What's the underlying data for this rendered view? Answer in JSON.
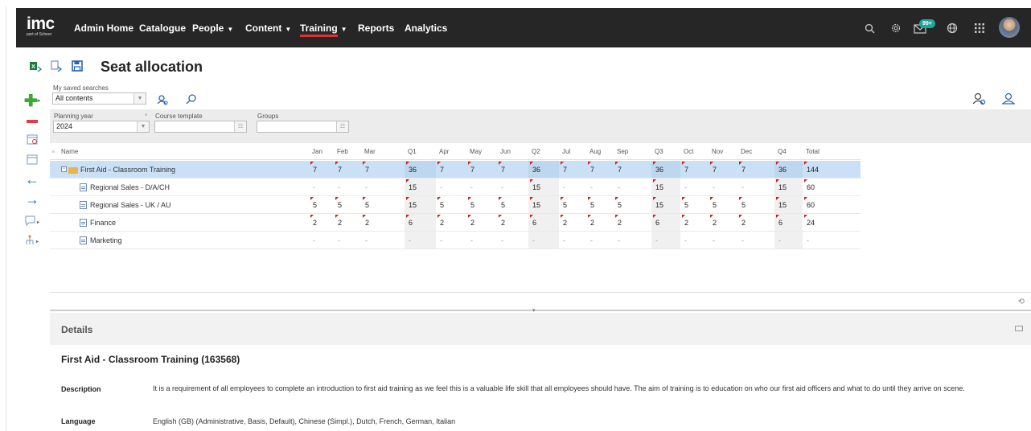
{
  "app": {
    "logo": "imc",
    "logo_sub": "part of Scheer"
  },
  "nav": [
    {
      "label": "Admin Home",
      "dropdown": false
    },
    {
      "label": "Catalogue",
      "dropdown": false
    },
    {
      "label": "People",
      "dropdown": true
    },
    {
      "label": "Content",
      "dropdown": true
    },
    {
      "label": "Training",
      "dropdown": true,
      "active": true
    },
    {
      "label": "Reports",
      "dropdown": false
    },
    {
      "label": "Analytics",
      "dropdown": false
    }
  ],
  "header_icons": [
    "search-icon",
    "gear-icon",
    "mail-icon",
    "globe-icon",
    "apps-grid-icon",
    "user-avatar"
  ],
  "mail_badge": "99+",
  "page_title": "Seat allocation",
  "search": {
    "saved_label": "My saved searches",
    "saved_value": "All contents",
    "year_label": "Planning year",
    "year_value": "2024",
    "template_label": "Course template",
    "template_value": "",
    "groups_label": "Groups",
    "groups_value": ""
  },
  "table": {
    "columns": [
      "Name",
      "Jan",
      "Feb",
      "Mar",
      "Q1",
      "Apr",
      "May",
      "Jun",
      "Q2",
      "Jul",
      "Aug",
      "Sep",
      "Q3",
      "Oct",
      "Nov",
      "Dec",
      "Q4",
      "Total"
    ],
    "rows": [
      {
        "name": "First Aid - Classroom Training",
        "level": 0,
        "values": [
          "7",
          "7",
          "7",
          "36",
          "7",
          "7",
          "7",
          "36",
          "7",
          "7",
          "7",
          "36",
          "7",
          "7",
          "7",
          "36",
          "144"
        ]
      },
      {
        "name": "Regional Sales - D/A/CH",
        "level": 1,
        "values": [
          "-",
          "-",
          "-",
          "15",
          "-",
          "-",
          "-",
          "15",
          "-",
          "-",
          "-",
          "15",
          "-",
          "-",
          "-",
          "15",
          "60"
        ]
      },
      {
        "name": "Regional Sales - UK / AU",
        "level": 1,
        "values": [
          "5",
          "5",
          "5",
          "15",
          "5",
          "5",
          "5",
          "15",
          "5",
          "5",
          "5",
          "15",
          "5",
          "5",
          "5",
          "15",
          "60"
        ]
      },
      {
        "name": "Finance",
        "level": 1,
        "values": [
          "2",
          "2",
          "2",
          "6",
          "2",
          "2",
          "2",
          "6",
          "2",
          "2",
          "2",
          "6",
          "2",
          "2",
          "2",
          "6",
          "24"
        ]
      },
      {
        "name": "Marketing",
        "level": 1,
        "values": [
          "-",
          "-",
          "-",
          "-",
          "-",
          "-",
          "-",
          "-",
          "-",
          "-",
          "-",
          "-",
          "-",
          "-",
          "-",
          "-",
          "-"
        ]
      }
    ]
  },
  "details": {
    "header": "Details",
    "title": "First Aid - Classroom Training (163568)",
    "description_label": "Description",
    "description": "It is a requirement of all employees to complete an introduction to first aid training as we feel this is a valuable life skill that all employees should have. The aim of training is to education on who our first aid officers and what to do until they arrive on scene.",
    "language_label": "Language",
    "language": "English (GB) (Administrative, Basis, Default), Chinese (Simpl.), Dutch, French, German, Italian"
  },
  "colors": {
    "topbar": "#262626",
    "accent_red": "#e03030",
    "badge": "#1fa89a",
    "selected_row": "#c9e0f5",
    "green": "#3aaa35",
    "blue": "#1f6fbf"
  }
}
